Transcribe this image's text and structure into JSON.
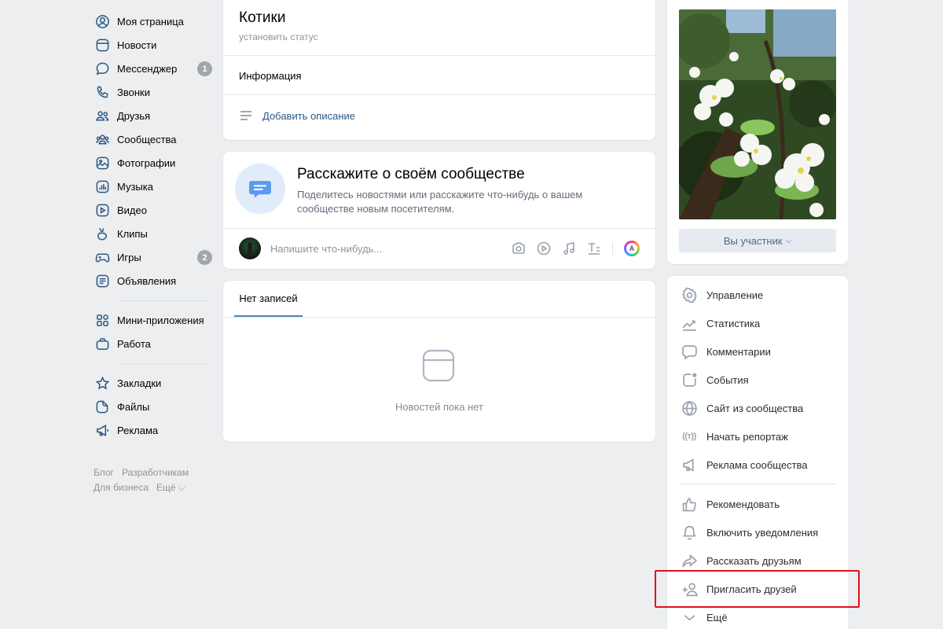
{
  "leftnav": {
    "items": [
      {
        "label": "Моя страница",
        "icon": "user-circle-icon"
      },
      {
        "label": "Новости",
        "icon": "news-icon"
      },
      {
        "label": "Мессенджер",
        "icon": "message-icon",
        "badge": "1"
      },
      {
        "label": "Звонки",
        "icon": "phone-icon"
      },
      {
        "label": "Друзья",
        "icon": "friends-icon"
      },
      {
        "label": "Сообщества",
        "icon": "communities-icon"
      },
      {
        "label": "Фотографии",
        "icon": "photo-icon"
      },
      {
        "label": "Музыка",
        "icon": "music-icon"
      },
      {
        "label": "Видео",
        "icon": "video-icon"
      },
      {
        "label": "Клипы",
        "icon": "clips-icon"
      },
      {
        "label": "Игры",
        "icon": "gamepad-icon",
        "badge": "2"
      },
      {
        "label": "Объявления",
        "icon": "ads-board-icon"
      }
    ],
    "items2": [
      {
        "label": "Мини-приложения",
        "icon": "apps-grid-icon"
      },
      {
        "label": "Работа",
        "icon": "briefcase-icon"
      }
    ],
    "items3": [
      {
        "label": "Закладки",
        "icon": "star-icon"
      },
      {
        "label": "Файлы",
        "icon": "file-icon"
      },
      {
        "label": "Реклама",
        "icon": "megaphone-icon"
      }
    ],
    "footer": {
      "blog": "Блог",
      "dev": "Разработчикам",
      "business": "Для бизнеса",
      "more": "Ещё ⌵"
    }
  },
  "group": {
    "title": "Котики",
    "status": "установить статус",
    "info": "Информация",
    "add_description": "Добавить описание"
  },
  "promo": {
    "title": "Расскажите о своём сообществе",
    "text": "Поделитесь новостями или расскажите что-нибудь о вашем сообществе новым посетителям.",
    "placeholder": "Напишите что-нибудь...",
    "ai_letter": "A"
  },
  "wall": {
    "tab": "Нет записей",
    "empty": "Новостей пока нет"
  },
  "side": {
    "member_button": "Вы участник",
    "menu1": [
      {
        "label": "Управление",
        "icon": "gear-icon"
      },
      {
        "label": "Статистика",
        "icon": "stats-icon"
      },
      {
        "label": "Комментарии",
        "icon": "comment-icon"
      },
      {
        "label": "События",
        "icon": "event-icon"
      },
      {
        "label": "Сайт из сообщества",
        "icon": "globe-icon"
      },
      {
        "label": "Начать репортаж",
        "icon": "broadcast-icon",
        "icon_text": "((т))"
      },
      {
        "label": "Реклама сообщества",
        "icon": "megaphone-icon"
      }
    ],
    "menu2": [
      {
        "label": "Рекомендовать",
        "icon": "thumbs-up-icon"
      },
      {
        "label": "Включить уведомления",
        "icon": "bell-icon"
      },
      {
        "label": "Рассказать друзьям",
        "icon": "share-icon"
      },
      {
        "label": "Пригласить друзей",
        "icon": "invite-user-icon"
      },
      {
        "label": "Ещё",
        "icon": "chevron-down-icon"
      }
    ]
  },
  "colors": {
    "accent": "#2a5885",
    "highlight": "#e0101e",
    "background": "#edeef0"
  }
}
